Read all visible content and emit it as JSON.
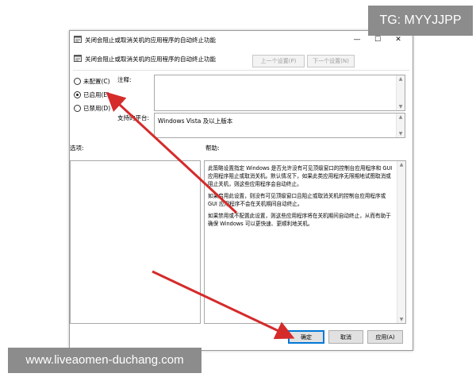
{
  "window": {
    "title": "关闭会阻止或取消关机的应用程序的自动终止功能",
    "minimize_glyph": "—",
    "maximize_glyph": "☐",
    "close_glyph": "✕"
  },
  "header": {
    "title": "关闭会阻止或取消关机的应用程序的自动终止功能",
    "prev_setting_label": "上一个设置(P)",
    "next_setting_label": "下一个设置(N)"
  },
  "options": {
    "not_configured": "未配置(C)",
    "enabled": "已启用(E)",
    "disabled": "已禁用(D)",
    "selected": "enabled"
  },
  "comment": {
    "label": "注释:",
    "value": ""
  },
  "supported": {
    "label": "支持的平台:",
    "value": "Windows Vista 及以上版本"
  },
  "options_section_label": "选项:",
  "help_section_label": "帮助:",
  "help_paragraphs": [
    "此策略设置指定 Windows 是否允许没有可见顶级窗口的控制台应用程序和 GUI 应用程序阻止或取消关机。默认情况下，如果此类应用程序无限期地试图取消或阻止关机，则这些应用程序会自动终止。",
    "如果启用此设置，则没有可见顶级窗口且阻止或取消关机的控制台应用程序或 GUI 应用程序不会在关机期间自动终止。",
    "如果禁用或不配置此设置，则这些应用程序将在关机期间自动终止，从而有助于确保 Windows 可以更快速、更顺利地关机。"
  ],
  "buttons": {
    "ok": "确定",
    "cancel": "取消",
    "apply": "应用(A)"
  },
  "watermarks": {
    "top_right": "TG: MYYJJPP",
    "bottom_left": "www.liveaomen-duchang.com"
  },
  "colors": {
    "annotation_arrow": "#d52b2b",
    "primary_button_border": "#0078d7",
    "watermark_bg": "#8c8c8c"
  }
}
